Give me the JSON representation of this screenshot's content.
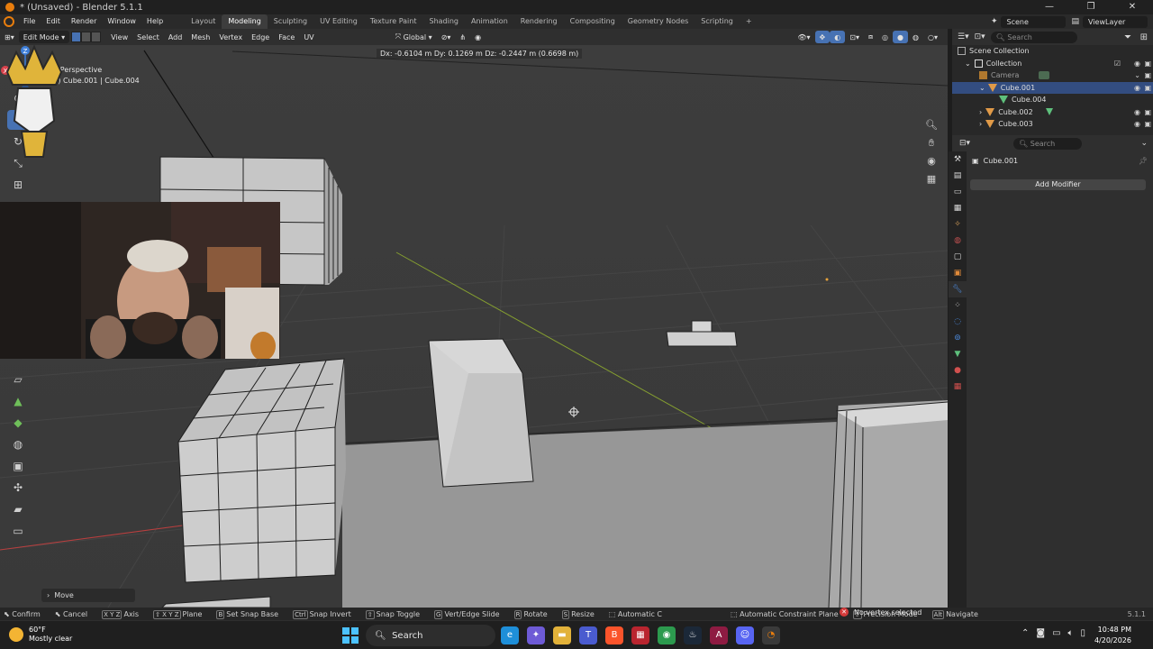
{
  "window": {
    "title": "* (Unsaved) - Blender 5.1.1",
    "controls": [
      "—",
      "❐",
      "✕"
    ]
  },
  "menu": [
    "File",
    "Edit",
    "Render",
    "Window",
    "Help"
  ],
  "workspaces": [
    "Layout",
    "Modeling",
    "Sculpting",
    "UV Editing",
    "Texture Paint",
    "Shading",
    "Animation",
    "Rendering",
    "Compositing",
    "Geometry Nodes",
    "Scripting",
    "+"
  ],
  "active_workspace": "Modeling",
  "scene": {
    "name": "Scene",
    "view_layer": "ViewLayer"
  },
  "viewport_header": {
    "mode": "Edit Mode",
    "menus": [
      "View",
      "Select",
      "Add",
      "Mesh",
      "Vertex",
      "Edge",
      "Face",
      "UV"
    ],
    "transform_orientation": "Global"
  },
  "viewport": {
    "perspective_label": "User Perspective",
    "object_info": "(217) Cube.001 | Cube.004",
    "delta_readout": "Dx: -0.6104 m   Dy:  0.1269 m   Dz: -0.2447 m (0.6698 m)",
    "gizmo_axes": [
      "X",
      "Y",
      "Z"
    ],
    "last_operator_panel": "Move"
  },
  "outliner": {
    "search_placeholder": "Search",
    "rows": [
      {
        "label": "Scene Collection",
        "indent": 0
      },
      {
        "label": "Collection",
        "indent": 1
      },
      {
        "label": "Camera",
        "indent": 2
      },
      {
        "label": "Cube.001",
        "indent": 2,
        "selected": true
      },
      {
        "label": "Cube.004",
        "indent": 3
      },
      {
        "label": "Cube.002",
        "indent": 2
      },
      {
        "label": "Cube.003",
        "indent": 2
      }
    ]
  },
  "properties": {
    "search_placeholder": "Search",
    "object_name": "Cube.001",
    "add_modifier_label": "Add Modifier"
  },
  "statusbar": {
    "items": [
      {
        "key": "",
        "label": "Confirm"
      },
      {
        "key": "",
        "label": "Cancel"
      },
      {
        "key": "X Y Z",
        "label": "Axis"
      },
      {
        "key": "⇧ X Y Z",
        "label": "Plane"
      },
      {
        "key": "B",
        "label": "Set Snap Base"
      },
      {
        "key": "Ctrl",
        "label": "Snap Invert"
      },
      {
        "key": "⇧",
        "label": "Snap Toggle"
      },
      {
        "key": "G",
        "label": "Vert/Edge Slide"
      },
      {
        "key": "R",
        "label": "Rotate"
      },
      {
        "key": "S",
        "label": "Resize"
      },
      {
        "key": "",
        "label": "Automatic C"
      },
      {
        "key": "",
        "label": "Automatic Constraint Plane"
      },
      {
        "key": "⇧",
        "label": "Precision Mode"
      },
      {
        "key": "Alt",
        "label": "Navigate"
      }
    ],
    "warning": "No vertex selected",
    "version": "5.1.1"
  },
  "taskbar": {
    "weather_temp": "60°F",
    "weather_desc": "Mostly clear",
    "search_label": "Search",
    "time": "10:48 PM",
    "date": "4/20/2026"
  },
  "colors": {
    "accent": "#4772b3",
    "blender_orange": "#e87d0d",
    "outliner_selected": "#334d80",
    "error_red": "#d33b3b"
  }
}
